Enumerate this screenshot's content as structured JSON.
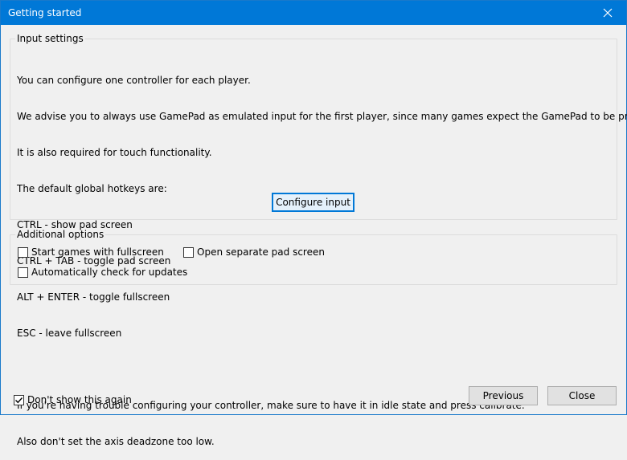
{
  "window": {
    "title": "Getting started"
  },
  "input_settings": {
    "legend": "Input settings",
    "lines": [
      "You can configure one controller for each player.",
      "We advise you to always use GamePad as emulated input for the first player, since many games expect the GamePad to be present.",
      "It is also required for touch functionality.",
      "The default global hotkeys are:",
      "CTRL - show pad screen",
      "CTRL + TAB - toggle pad screen",
      "ALT + ENTER - toggle fullscreen",
      "ESC - leave fullscreen",
      "",
      "If you're having trouble configuring your controller, make sure to have it in idle state and press calibrate.",
      "Also don't set the axis deadzone too low."
    ],
    "configure_button": "Configure input"
  },
  "additional_options": {
    "legend": "Additional options",
    "start_fullscreen": {
      "label": "Start games with fullscreen",
      "checked": false
    },
    "separate_pad": {
      "label": "Open separate pad screen",
      "checked": false
    },
    "auto_update": {
      "label": "Automatically check for updates",
      "checked": false
    }
  },
  "footer": {
    "dont_show": {
      "label": "Don't show this again",
      "checked": true
    },
    "previous_button": "Previous",
    "close_button": "Close"
  },
  "colors": {
    "accent": "#0078d7",
    "background": "#f0f0f0",
    "group_border": "#dcdcdc"
  },
  "icons": {
    "close": "close-icon",
    "check": "checkmark-icon"
  }
}
